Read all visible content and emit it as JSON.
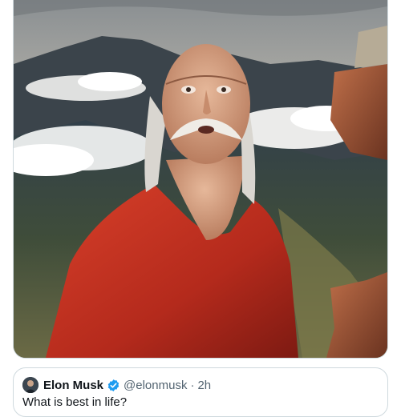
{
  "media": {
    "icon": "media-image"
  },
  "quoted_post": {
    "author_name": "Elon Musk",
    "author_handle": "@elonmusk",
    "separator": "·",
    "time": "2h",
    "text": "What is best in life?",
    "verified_color": "#1d9bf0",
    "icons": [
      "avatar",
      "verified-badge-icon"
    ]
  }
}
